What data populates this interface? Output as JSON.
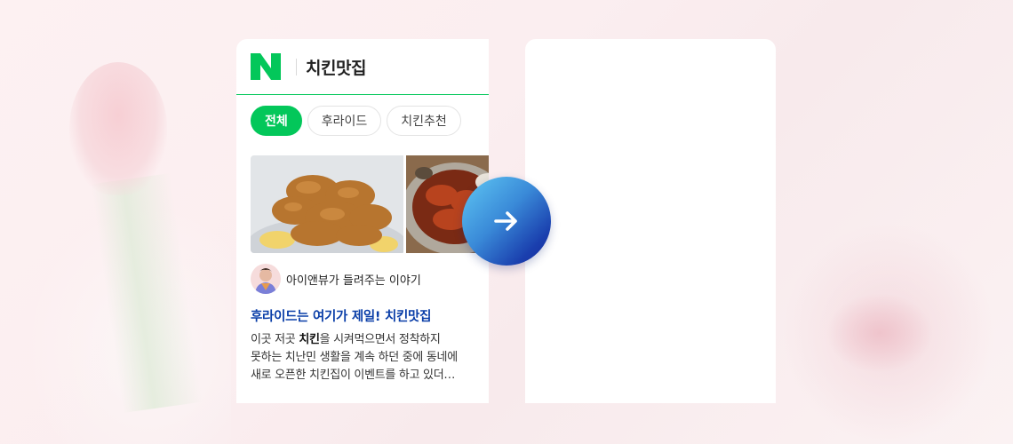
{
  "search": {
    "query": "치킨맛집"
  },
  "brand": {
    "accent": "#03c75a",
    "link": "#0a3ea8"
  },
  "chips": [
    {
      "label": "전체",
      "active": true
    },
    {
      "label": "후라이드",
      "active": false
    },
    {
      "label": "치킨추천",
      "active": false
    }
  ],
  "post": {
    "author": "아이앤뷰가 들려주는 이야기",
    "title_prefix": "후라이드는 여기가 제일! ",
    "title_highlight": "치킨맛집",
    "body_line1_pre": "이곳 저곳 ",
    "body_line1_bold": "치킨",
    "body_line1_post": "을 시켜먹으면서 정착하지",
    "body_line2": "못하는 치난민 생활을 계속 하던 중에 동네에",
    "body_line3": "새로 오픈한 치킨집이 이벤트를 하고 있더…"
  },
  "icons": {
    "logo": "naver-n-logo",
    "next": "arrow-right-icon"
  }
}
